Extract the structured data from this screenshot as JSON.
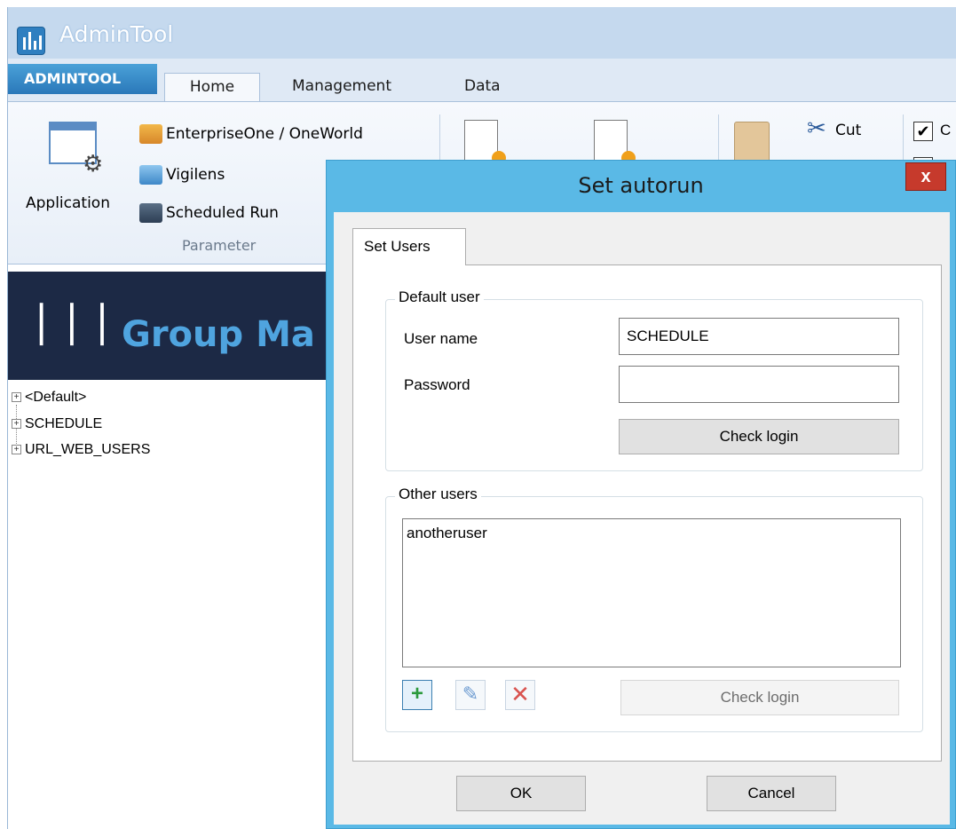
{
  "app": {
    "title": "AdminTool",
    "file_tab": "ADMINTOOL",
    "tabs": [
      "Home",
      "Management",
      "Data"
    ]
  },
  "ribbon": {
    "application_label": "Application",
    "parameter_items": [
      "EnterpriseOne / OneWorld",
      "Vigilens",
      "Scheduled Run"
    ],
    "group_label": "Parameter",
    "cut_label": "Cut",
    "check_label": "C",
    "check_1_checked": true
  },
  "left_pane": {
    "banner_text": "Group Ma",
    "tree_items": [
      "<Default>",
      "SCHEDULE",
      "URL_WEB_USERS"
    ]
  },
  "dialog": {
    "title": "Set autorun",
    "close_label": "x",
    "tab_label": "Set Users",
    "default_user": {
      "group_title": "Default user",
      "user_name_label": "User name",
      "user_name_value": "SCHEDULE",
      "password_label": "Password",
      "password_value": "",
      "check_login_label": "Check login"
    },
    "other_users": {
      "group_title": "Other users",
      "items": [
        "anotheruser"
      ],
      "add_label": "+",
      "edit_label": "✎",
      "delete_label": "✕",
      "check_login_label": "Check login",
      "check_login_enabled": false
    },
    "ok_label": "OK",
    "cancel_label": "Cancel"
  },
  "colors": {
    "dialog_frame": "#5ab9e6",
    "close_button": "#c63a2c",
    "banner_bg": "#1c2945",
    "banner_text": "#4fa4df",
    "file_tab": "#2a78b9"
  }
}
